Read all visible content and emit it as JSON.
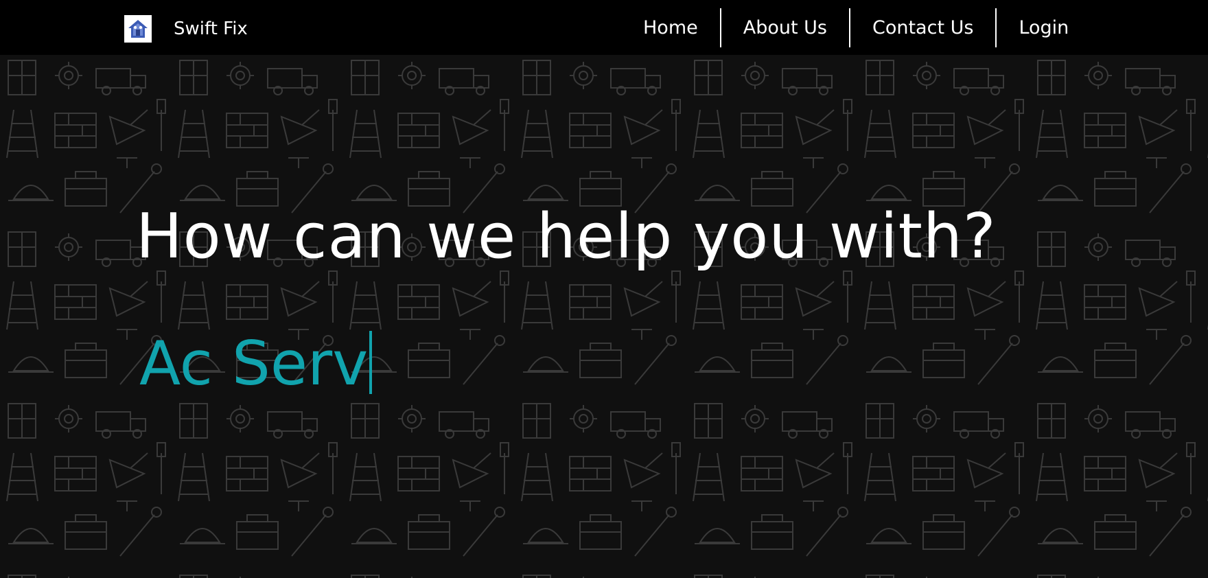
{
  "brand": {
    "name": "Swift Fix",
    "logo_icon": "house-logo-icon"
  },
  "nav": {
    "items": [
      {
        "label": "Home"
      },
      {
        "label": "About Us"
      },
      {
        "label": "Contact Us"
      },
      {
        "label": "Login"
      }
    ]
  },
  "hero": {
    "headline": "How can we help you with?",
    "typed_text": "Ac Serv",
    "background_pattern": "construction-tools-pattern"
  },
  "colors": {
    "navbar_bg": "#000000",
    "hero_bg": "#101010",
    "pattern_line": "#3a3a3a",
    "text": "#ffffff",
    "accent": "#11a3ad"
  }
}
